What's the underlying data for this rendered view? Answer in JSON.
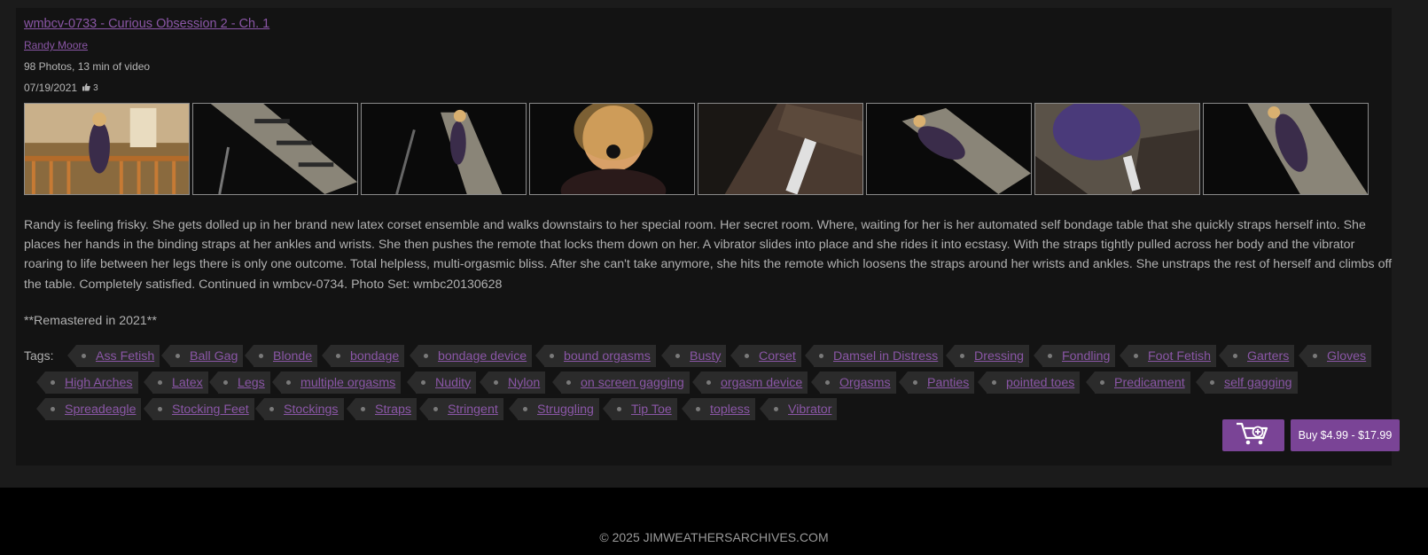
{
  "scene": {
    "title": "wmbcv-0733 - Curious Obsession 2 - Ch. 1",
    "author": "Randy Moore",
    "stats": "98 Photos, 13 min of video",
    "date": "07/19/2021",
    "likes": "3",
    "like_icon": "thumbs-up-icon",
    "gallery_count": 8,
    "description": "Randy is feeling frisky. She gets dolled up in her brand new latex corset ensemble and walks downstairs to her special room. Her secret room. Where, waiting for her is her automated self bondage table that she quickly straps herself into. She places her hands in the binding straps at her ankles and wrists. She then pushes the remote that locks them down on her. A vibrator slides into place and she rides it into ecstasy. With the straps tightly pulled across her body and the vibrator roaring to life between her legs there is only one outcome. Total helpless, multi-orgasmic bliss. After she can't take anymore, she hits the remote which loosens the straps around her wrists and ankles. She unstraps the rest of herself and climbs off the table. Completely satisfied. Continued in wmbcv-0734. Photo Set: wmbc20130628",
    "remaster_note": "**Remastered in 2021**"
  },
  "tags": {
    "label": "Tags:",
    "items": [
      "Ass Fetish",
      "Ball Gag",
      "Blonde",
      "bondage",
      "bondage device",
      "bound orgasms",
      "Busty",
      "Corset",
      "Damsel in Distress",
      "Dressing",
      "Fondling",
      "Foot Fetish",
      "Garters",
      "Gloves",
      "High Arches",
      "Latex",
      "Legs",
      "multiple orgasms",
      "Nudity",
      "Nylon",
      "on screen gagging",
      "orgasm device",
      "Orgasms",
      "Panties",
      "pointed toes",
      "Predicament",
      "self gagging",
      "Spreadeagle",
      "Stocking Feet",
      "Stockings",
      "Straps",
      "Stringent",
      "Struggling",
      "Tip Toe",
      "topless",
      "Vibrator"
    ]
  },
  "purchase": {
    "cart_icon": "add-to-cart-icon",
    "buy_label": "Buy $4.99 - $17.99"
  },
  "footer": {
    "copyright": "© 2025 JIMWEATHERSARCHIVES.COM"
  },
  "colors": {
    "accent": "#7a4496",
    "link": "#8a56a6",
    "card": "#131313",
    "tag_bg": "#2b2b2b"
  }
}
